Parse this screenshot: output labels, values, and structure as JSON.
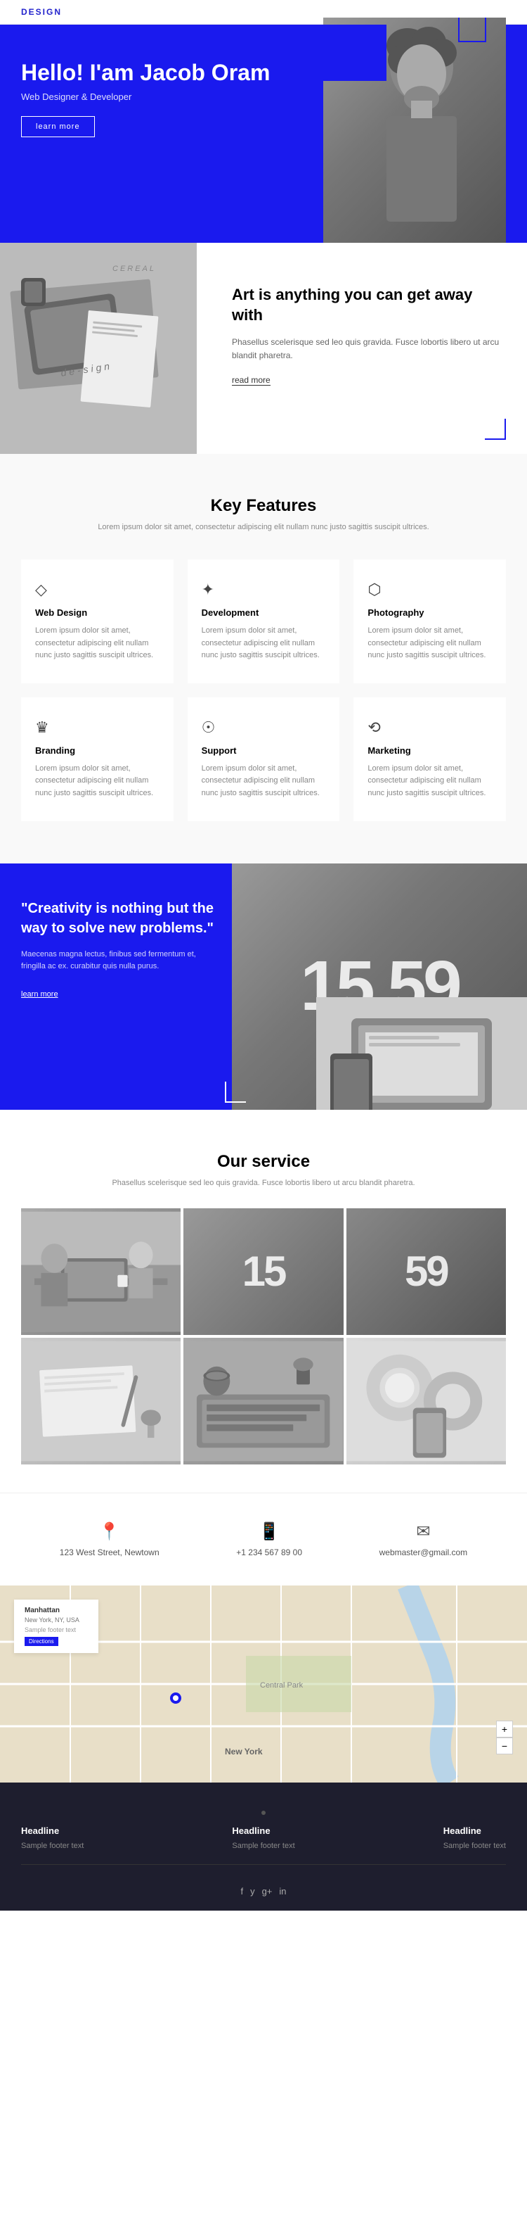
{
  "topbar": {
    "brand": "DESIGN"
  },
  "hero": {
    "greeting": "Hello! I'am Jacob Oram",
    "subtitle": "Web Designer & Developer",
    "button": "learn more"
  },
  "art": {
    "title": "Art is anything you can get away with",
    "description": "Phasellus scelerisque sed leo quis gravida. Fusce lobortis libero ut arcu blandit pharetra.",
    "link": "read more"
  },
  "features": {
    "title": "Key Features",
    "subtitle": "Lorem ipsum dolor sit amet, consectetur adipiscing elit nullam nunc justo sagittis suscipit ultrices.",
    "items": [
      {
        "icon": "◇",
        "name": "Web Design",
        "desc": "Lorem ipsum dolor sit amet, consectetur adipiscing elit nullam nunc justo sagittis suscipit ultrices."
      },
      {
        "icon": "✦",
        "name": "Development",
        "desc": "Lorem ipsum dolor sit amet, consectetur adipiscing elit nullam nunc justo sagittis suscipit ultrices."
      },
      {
        "icon": "⬡",
        "name": "Photography",
        "desc": "Lorem ipsum dolor sit amet, consectetur adipiscing elit nullam nunc justo sagittis suscipit ultrices."
      },
      {
        "icon": "♛",
        "name": "Branding",
        "desc": "Lorem ipsum dolor sit amet, consectetur adipiscing elit nullam nunc justo sagittis suscipit ultrices."
      },
      {
        "icon": "☉",
        "name": "Support",
        "desc": "Lorem ipsum dolor sit amet, consectetur adipiscing elit nullam nunc justo sagittis suscipit ultrices."
      },
      {
        "icon": "⟲",
        "name": "Marketing",
        "desc": "Lorem ipsum dolor sit amet, consectetur adipiscing elit nullam nunc justo sagittis suscipit ultrices."
      }
    ]
  },
  "quote": {
    "text": "\"Creativity is nothing but the way to solve new problems.\"",
    "description": "Maecenas magna lectus, finibus sed fermentum et, fringilla ac ex. curabitur quis nulla purus.",
    "button": "learn more",
    "numbers": "15 59"
  },
  "service": {
    "title": "Our service",
    "subtitle": "Phasellus scelerisque sed leo quis gravida. Fusce lobortis libero ut arcu blandit pharetra."
  },
  "contact": {
    "address": "123 West Street, Newtown",
    "phone": "+1 234 567 89 00",
    "email": "webmaster@gmail.com"
  },
  "map": {
    "card_title": "Manhattan",
    "card_subtitle": "New York, NY, USA",
    "card_detail": "Sample footer text",
    "label_top": "New York"
  },
  "footer": {
    "columns": [
      {
        "title": "Headline",
        "text": "Sample footer text"
      },
      {
        "title": "Headline",
        "text": "Sample footer text"
      },
      {
        "title": "Headline",
        "text": "Sample footer text"
      }
    ],
    "social": [
      "f",
      "y",
      "g+",
      "in"
    ]
  }
}
